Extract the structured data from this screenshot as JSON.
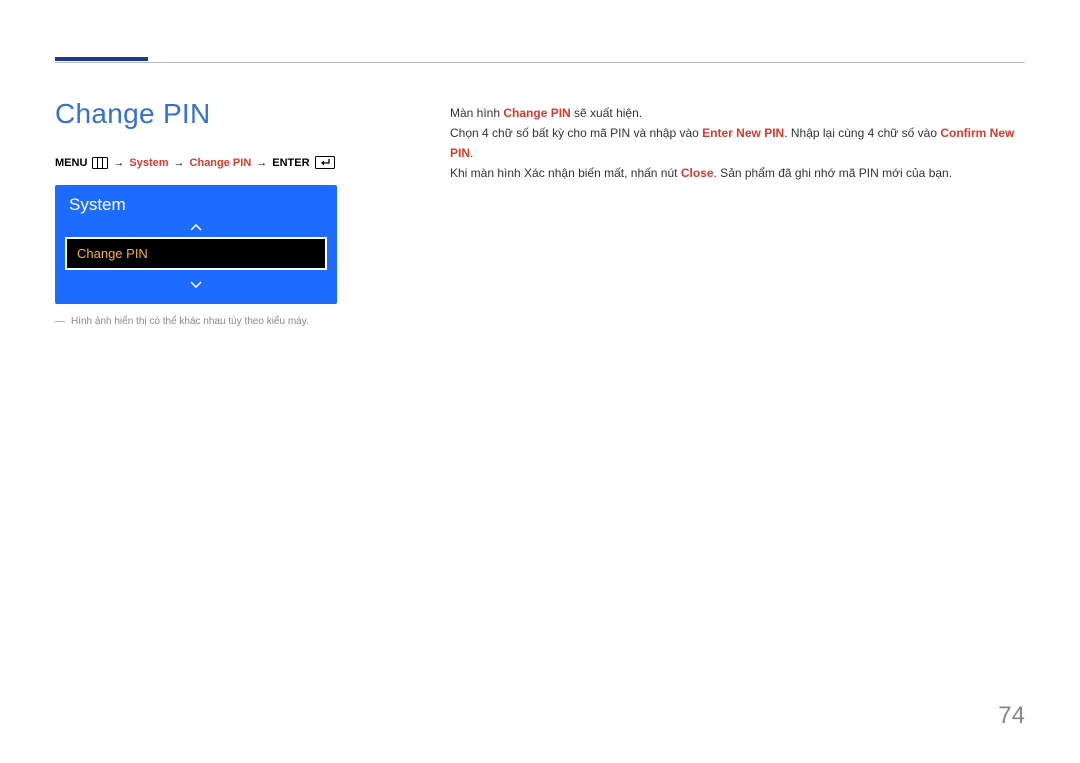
{
  "page": {
    "title": "Change PIN",
    "number": "74"
  },
  "breadcrumb": {
    "menu": "MENU",
    "system": "System",
    "change_pin": "Change PIN",
    "enter": "ENTER"
  },
  "osd": {
    "title": "System",
    "item": "Change PIN"
  },
  "disclaimer": "Hình ảnh hiển thị có thể khác nhau tùy theo kiểu máy.",
  "body": {
    "line1_pre": "Màn hình ",
    "line1_em": "Change PIN",
    "line1_post": " sẽ xuất hiện.",
    "line2_pre": "Chọn 4 chữ số bất kỳ cho mã PIN và nhập vào ",
    "line2_em1": "Enter New PIN",
    "line2_mid": ". Nhập lại cùng 4 chữ số vào ",
    "line2_em2": "Confirm New PIN",
    "line2_post": ".",
    "line3_pre": "Khi màn hình Xác nhận biến mất, nhấn nút ",
    "line3_em": "Close",
    "line3_post": ". Sản phẩm đã ghi nhớ mã PIN mới của bạn."
  }
}
